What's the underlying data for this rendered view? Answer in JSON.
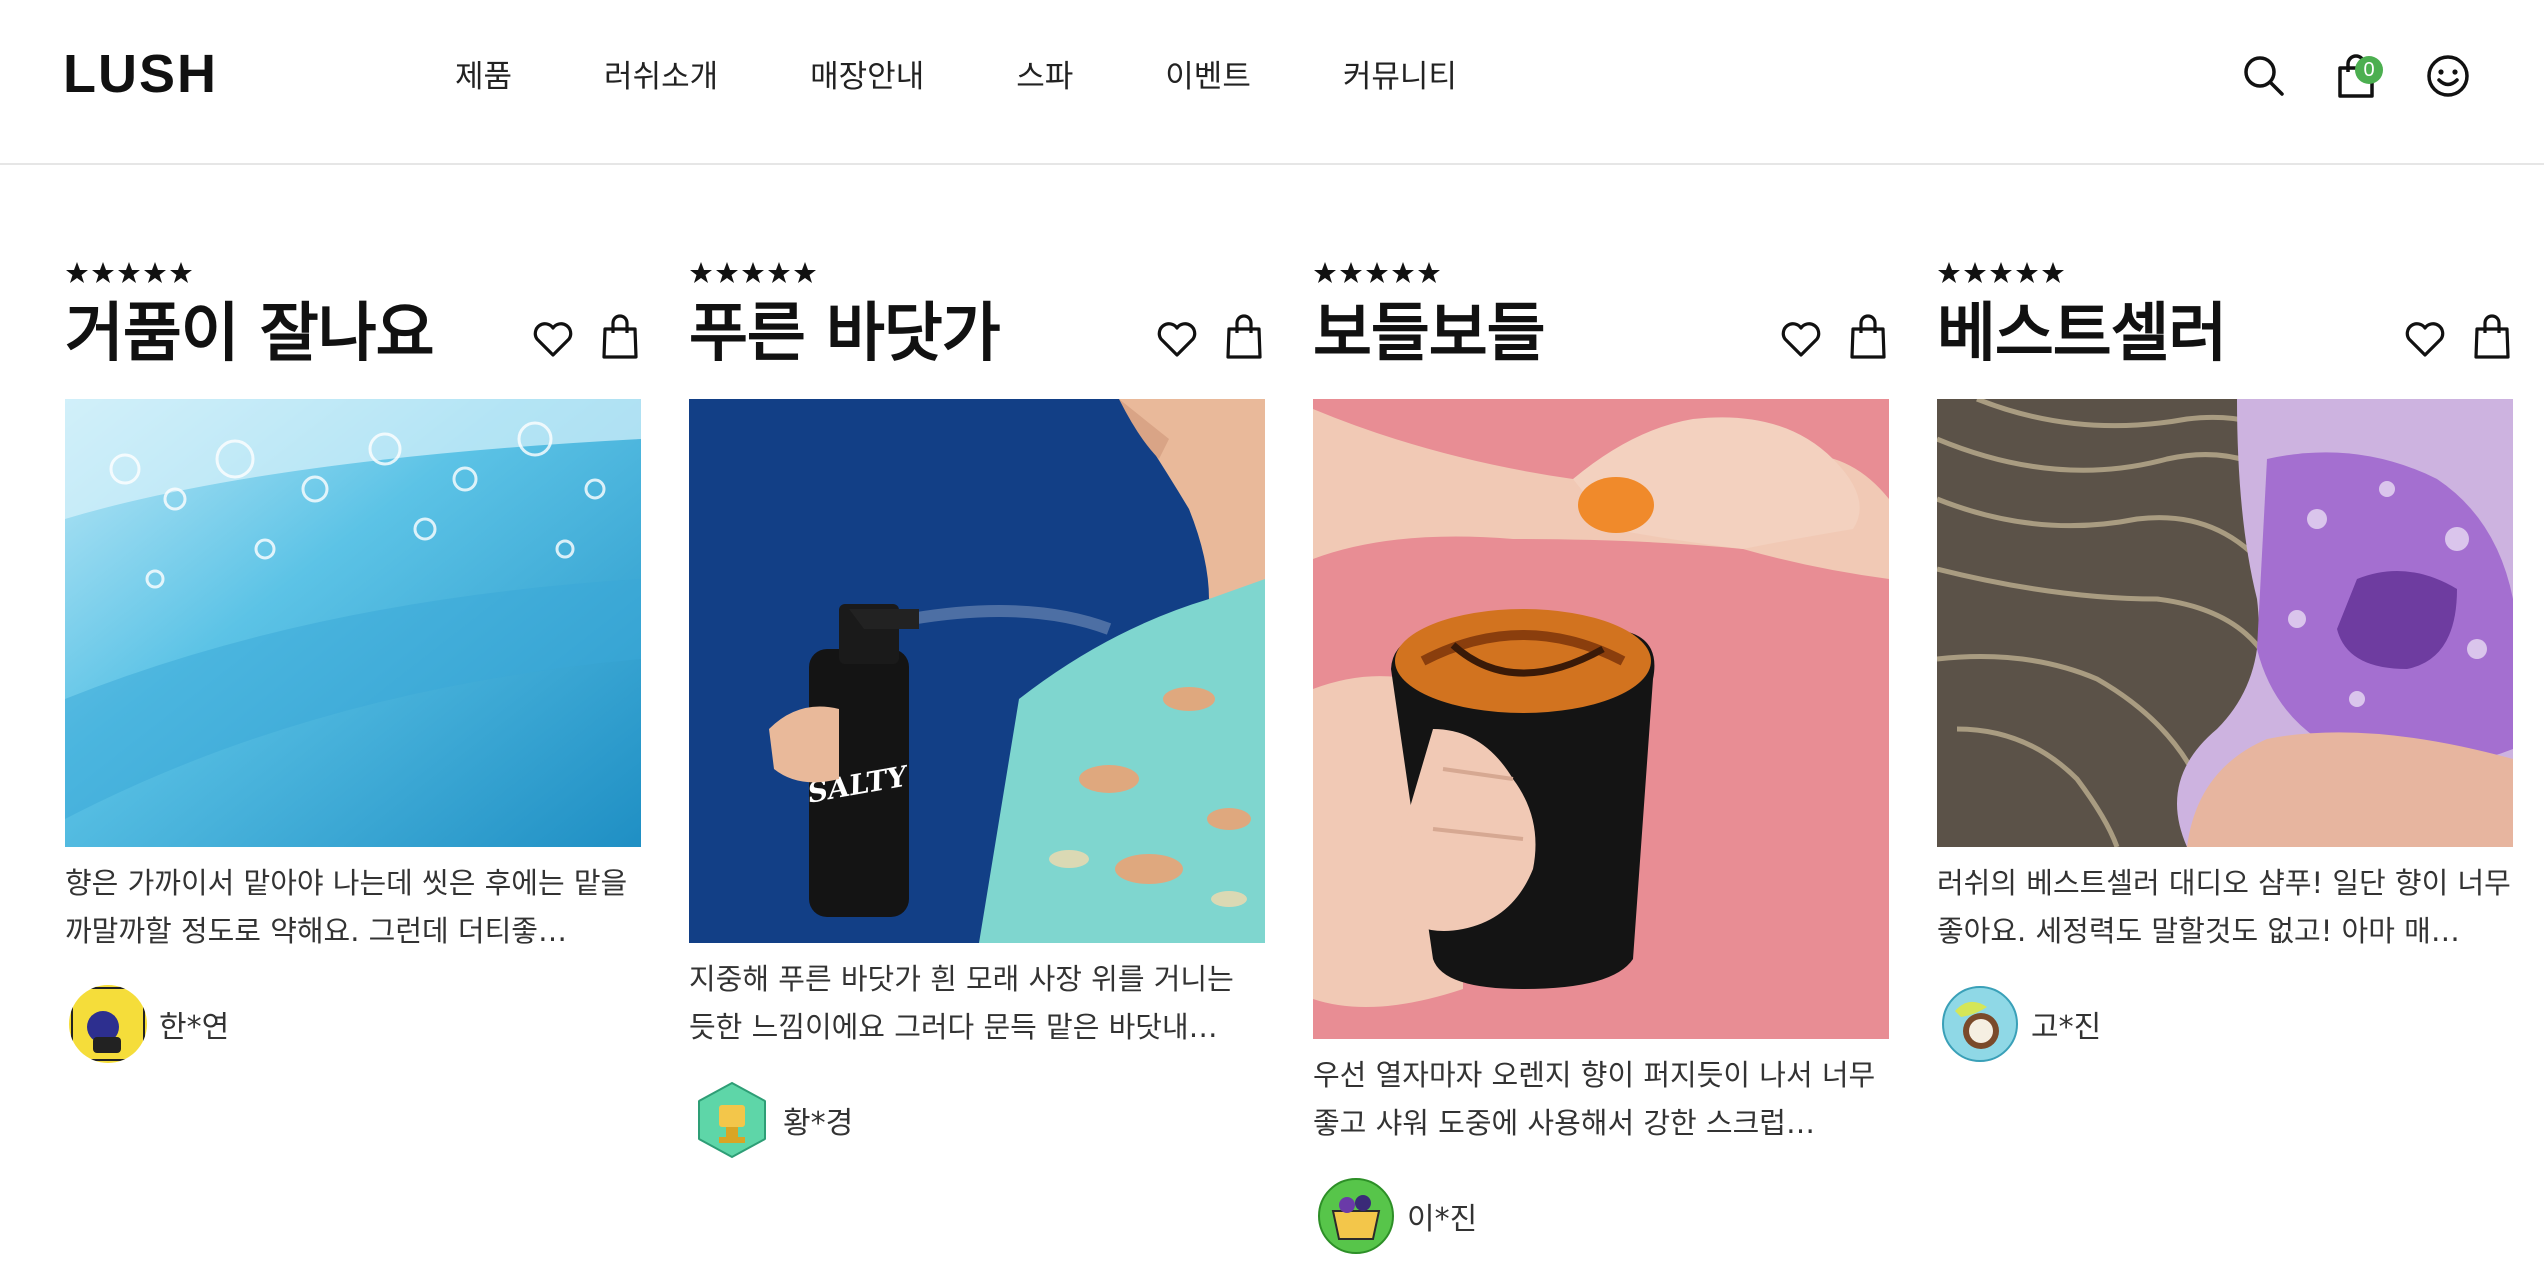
{
  "brand": {
    "logo": "LUSH"
  },
  "nav": {
    "items": [
      "제품",
      "러쉬소개",
      "매장안내",
      "스파",
      "이벤트",
      "커뮤니티"
    ]
  },
  "header_icons": {
    "search": "search-icon",
    "cart": "cart-icon",
    "account": "smiley-icon",
    "cart_count": "0"
  },
  "colors": {
    "badge": "#4caf50",
    "text": "#111111"
  },
  "cards": [
    {
      "rating": 5,
      "title": "거품이 잘나요",
      "review": "향은 가까이서 맡아야 나는데 씻은 후에는 맡을까말까할 정도로 약해요. 그런데 더티좋…",
      "author": "한*연"
    },
    {
      "rating": 5,
      "title": "푸른 바닷가",
      "review": "지중해 푸른 바닷가 흰 모래 사장 위를 거니는 듯한 느낌이에요 그러다 문득 맡은 바닷내…",
      "author": "황*경"
    },
    {
      "rating": 5,
      "title": "보들보들",
      "review": "우선 열자마자 오렌지 향이 퍼지듯이 나서 너무 좋고 샤워 도중에 사용해서 강한 스크럽…",
      "author": "이*진"
    },
    {
      "rating": 5,
      "title": "베스트셀러",
      "review": "러쉬의 베스트셀러 대디오 샴푸! 일단 향이 너무 좋아요. 세정력도 말할것도 없고! 아마 매…",
      "author": "고*진"
    }
  ]
}
